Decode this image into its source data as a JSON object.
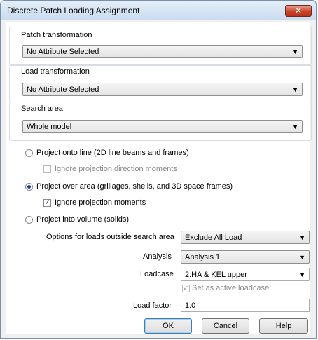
{
  "window": {
    "title": "Discrete Patch Loading Assignment",
    "close_label": "✕"
  },
  "patch_transformation": {
    "label": "Patch transformation",
    "value": "No Attribute Selected"
  },
  "load_transformation": {
    "label": "Load transformation",
    "value": "No Attribute Selected"
  },
  "search_area": {
    "label": "Search area",
    "value": "Whole model"
  },
  "projection": {
    "line": {
      "label": "Project onto line (2D line beams and frames)",
      "selected": false
    },
    "line_ignore": {
      "label": "Ignore projection direction moments",
      "checked": false,
      "enabled": false
    },
    "area": {
      "label": "Project over area (grillages, shells, and 3D space frames)",
      "selected": true
    },
    "area_ignore": {
      "label": "Ignore projection moments",
      "checked": true,
      "enabled": true
    },
    "volume": {
      "label": "Project into volume (solids)",
      "selected": false
    }
  },
  "options": {
    "outside_label": "Options for loads outside search area",
    "outside_value": "Exclude All Load",
    "analysis_label": "Analysis",
    "analysis_value": "Analysis 1",
    "loadcase_label": "Loadcase",
    "loadcase_value": "2:HA & KEL upper",
    "active_label": "Set as active loadcase",
    "load_factor_label": "Load factor",
    "load_factor_value": "1.0"
  },
  "buttons": {
    "ok": "OK",
    "cancel": "Cancel",
    "help": "Help"
  },
  "icons": {
    "dropdown": "▼",
    "check": "✓"
  },
  "colors": {
    "title_bar": "#c9dbef",
    "close_button": "#c7442a",
    "accent": "#1d3e8a"
  }
}
